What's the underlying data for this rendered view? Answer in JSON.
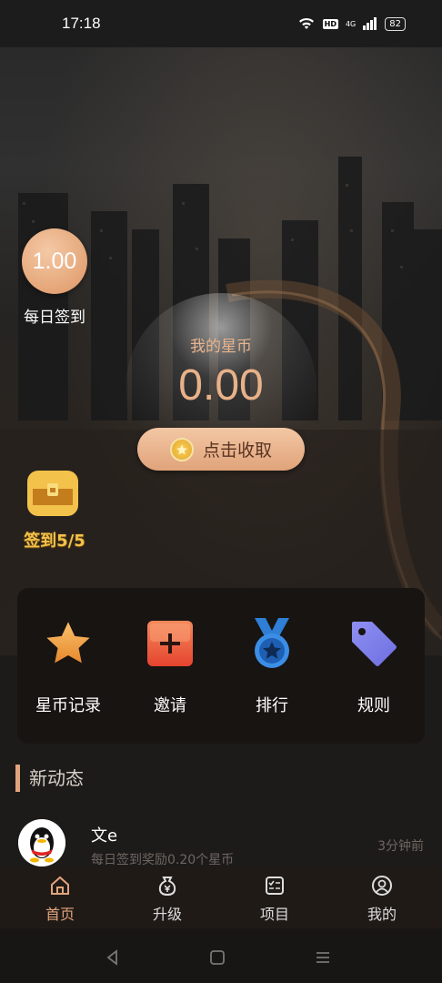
{
  "status_bar": {
    "time": "17:18",
    "battery": "82",
    "hd": "HD",
    "network": "4G"
  },
  "sign_in": {
    "amount": "1.00",
    "label": "每日签到"
  },
  "chest": {
    "label": "签到5/5"
  },
  "wallet": {
    "label": "我的星币",
    "value": "0.00",
    "collect_label": "点击收取"
  },
  "menu": [
    {
      "label": "星币记录",
      "icon": "star-icon"
    },
    {
      "label": "邀请",
      "icon": "plus-icon"
    },
    {
      "label": "排行",
      "icon": "medal-icon"
    },
    {
      "label": "规则",
      "icon": "tag-icon"
    }
  ],
  "news": {
    "title": "新动态",
    "items": [
      {
        "name": "文e",
        "desc": "每日签到奖励0.20个星币",
        "time": "3分钟前"
      }
    ]
  },
  "tabs": [
    {
      "label": "首页",
      "icon": "home-icon"
    },
    {
      "label": "升级",
      "icon": "money-bag-icon"
    },
    {
      "label": "项目",
      "icon": "checklist-icon"
    },
    {
      "label": "我的",
      "icon": "user-icon"
    }
  ],
  "colors": {
    "accent": "#e4a577",
    "gold": "#f3c24b",
    "active_tab": "#e0a47c"
  }
}
